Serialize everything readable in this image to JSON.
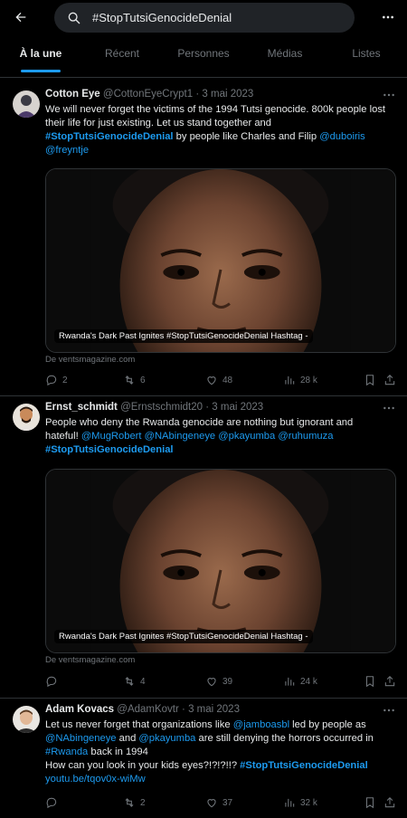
{
  "search": {
    "query": "#StopTutsiGenocideDenial"
  },
  "tabs": [
    {
      "label": "À la une",
      "active": true
    },
    {
      "label": "Récent"
    },
    {
      "label": "Personnes"
    },
    {
      "label": "Médias"
    },
    {
      "label": "Listes"
    }
  ],
  "icons": {
    "back": "arrow-left-icon",
    "search": "magnifier-icon",
    "more": "ellipsis-icon",
    "reply": "speech-bubble-icon",
    "retweet": "retweet-icon",
    "like": "heart-icon",
    "views": "bar-chart-icon",
    "bookmark": "bookmark-icon",
    "share": "share-icon"
  },
  "colors": {
    "accent": "#1d9bf0",
    "muted": "#71767b",
    "text": "#e7e9ea",
    "border": "#2f3336"
  },
  "tweets": [
    {
      "name": "Cotton Eye",
      "handle": "@CottonEyeCrypt1",
      "sep": "·",
      "date": "3 mai 2023",
      "text": {
        "p1": "We will never forget the victims of the 1994 Tutsi genocide. 800k people lost their life for just existing. Let us stand together and ",
        "hashtag": "#StopTutsiGenocideDenial",
        "p2": " by people like Charles and Filip ",
        "m1": "@duboiris",
        "m2": "@freyntje"
      },
      "card": {
        "caption": "Rwanda's Dark Past Ignites #StopTutsiGenocideDenial Hashtag  -",
        "source": "De ventsmagazine.com"
      },
      "stats": {
        "replies": "2",
        "retweets": "6",
        "likes": "48",
        "views": "28 k"
      }
    },
    {
      "name": "Ernst_schmidt",
      "handle": "@Ernstschmidt20",
      "sep": "·",
      "date": "3 mai 2023",
      "text": {
        "p1": "People who deny the Rwanda genocide are nothing but ignorant and hateful! ",
        "m1": "@MugRobert",
        "m2": "@NAbingeneye",
        "m3": "@pkayumba",
        "m4": "@ruhumuza",
        "hashtag": "#StopTutsiGenocideDenial"
      },
      "card": {
        "caption": "Rwanda's Dark Past Ignites #StopTutsiGenocideDenial Hashtag  -",
        "source": "De ventsmagazine.com"
      },
      "stats": {
        "replies": "",
        "retweets": "4",
        "likes": "39",
        "views": "24 k"
      }
    },
    {
      "name": "Adam Kovacs",
      "handle": "@AdamKovtr",
      "sep": "·",
      "date": "3 mai 2023",
      "text": {
        "p1": "Let us never forget that organizations like ",
        "m1": "@jamboasbl",
        "p2": " led by people as ",
        "m2": "@NAbingeneye",
        "p3": " and  ",
        "m3": "@pkayumba",
        "p4": " are still denying the horrors occurred in ",
        "h1": "#Rwanda",
        "p5": "  back in 1994",
        "p6": "How can you look in your kids eyes?!?!?!!? ",
        "h2": "#StopTutsiGenocideDenial",
        "link": "youtu.be/tqov0x-wiMw"
      },
      "stats": {
        "replies": "",
        "retweets": "2",
        "likes": "37",
        "views": "32 k"
      }
    }
  ]
}
